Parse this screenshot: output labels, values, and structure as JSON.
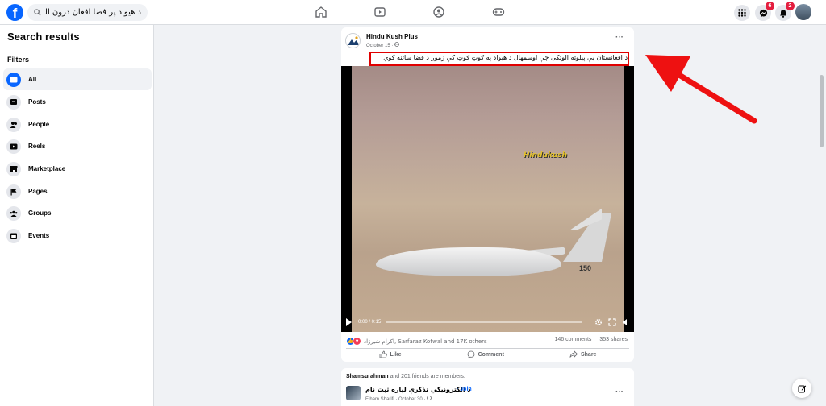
{
  "header": {
    "logo_letter": "f",
    "search_value": "د هیواد پر فضا افغان درون الوتکې",
    "notifications": {
      "messenger_count": "6",
      "bell_count": "2"
    }
  },
  "sidebar": {
    "title": "Search results",
    "filters_label": "Filters",
    "items": [
      {
        "label": "All"
      },
      {
        "label": "Posts"
      },
      {
        "label": "People"
      },
      {
        "label": "Reels"
      },
      {
        "label": "Marketplace"
      },
      {
        "label": "Pages"
      },
      {
        "label": "Groups"
      },
      {
        "label": "Events"
      }
    ]
  },
  "post": {
    "page_name": "Hindu Kush Plus",
    "date": "October 15 · ",
    "caption": "د افغانستان بې پیلوټه الوتکې چې اوسمهال د هیواد په ګوټ ګوټ کې زموږ د فضا ساتنه کوي",
    "video": {
      "watermark": "Hindukush",
      "time": "0:00 / 0:15",
      "tail_number": "150"
    },
    "reactions_text": "اکرام شیرزاد, Sarfaraz Kotwal and 17K others",
    "comments": "146 comments",
    "shares": "353 shares",
    "actions": {
      "like": "Like",
      "comment": "Comment",
      "share": "Share"
    }
  },
  "post2": {
    "member_name": "Shamsurahman",
    "member_rest": " and 201 friends are members.",
    "group_name": "د الکترونیکي تذکرې لپاره ثبت نام",
    "join": "· Join",
    "byline": "Elham Sharifi · October 30 · "
  },
  "colors": {
    "brand": "#0866ff",
    "highlight": "#e00000",
    "badge": "#e41e3f"
  }
}
